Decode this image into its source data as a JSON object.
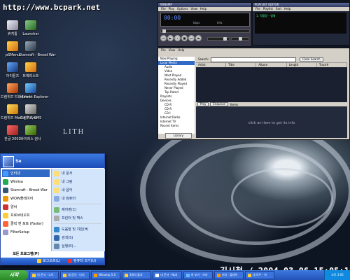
{
  "watermark": "http://www.bcpark.net",
  "brand_text": "LITH",
  "datestamp": "김시철 / 2004-03-06 15:05:18",
  "desktop_icons": [
    {
      "label": "휴지통",
      "icon": "recycle-bin-icon"
    },
    {
      "label": "Launcher",
      "icon": "launcher-icon"
    },
    {
      "label": "pSMenu",
      "icon": "app-icon"
    },
    {
      "label": "Starcraft - Brood War",
      "icon": "game-icon"
    },
    {
      "label": "아이튠즈",
      "icon": "app-icon"
    },
    {
      "label": "트랙리스트",
      "icon": "app-icon"
    },
    {
      "label": "드림위즈 티나(Lite)",
      "icon": "app-icon"
    },
    {
      "label": "Internet Explorer",
      "icon": "ie-icon"
    },
    {
      "label": "드림위즈 Media Player",
      "icon": "media-icon"
    },
    {
      "label": "드림위즈 SMS",
      "icon": "sms-icon"
    },
    {
      "label": "한글 2002",
      "icon": "document-icon"
    },
    {
      "label": "바이러스 검사",
      "icon": "shield-icon"
    }
  ],
  "start_menu": {
    "user_name": "Se",
    "left_items": [
      {
        "label": "인터넷",
        "sub": "Internet Explorer",
        "icon": "ie-icon",
        "selected": true
      },
      {
        "label": "Winlisa",
        "icon": "app-icon"
      },
      {
        "label": "Starcraft - Brood War",
        "icon": "game-icon"
      },
      {
        "label": "WOW플레이어",
        "icon": "media-icon"
      },
      {
        "label": "알씨",
        "icon": "image-icon"
      },
      {
        "label": "프로브네오프",
        "icon": "app-icon"
      },
      {
        "label": "클릭 앤 포토 (Faster)",
        "icon": "photo-icon"
      },
      {
        "label": "FilterSetup",
        "icon": "setup-icon"
      }
    ],
    "all_programs_label": "모든 프로그램(P)",
    "right_items": [
      {
        "label": "내 문서",
        "icon": "folder-icon"
      },
      {
        "label": "내 그림",
        "icon": "folder-icon"
      },
      {
        "label": "내 음악",
        "icon": "folder-icon"
      },
      {
        "label": "내 컴퓨터",
        "icon": "computer-icon"
      },
      {
        "label": "제어판(C)",
        "icon": "control-panel-icon"
      },
      {
        "label": "프린터 및 팩스",
        "icon": "printer-icon"
      },
      {
        "label": "도움말 및 지원(H)",
        "icon": "help-icon"
      },
      {
        "label": "검색(S)",
        "icon": "search-icon"
      },
      {
        "label": "실행(R)...",
        "icon": "run-icon"
      }
    ],
    "logoff_label": "로그오프(L)",
    "shutdown_label": "컴퓨터 끄기(U)"
  },
  "winamp": {
    "title": "WINAMP",
    "menu": [
      "File",
      "Play",
      "Options",
      "View",
      "Help"
    ],
    "time": "00:00",
    "bitrate": "kbps",
    "khz": "kHz"
  },
  "playlist": {
    "title": "PLAYLIST EDITOR",
    "menu": [
      "File",
      "Playlist",
      "Sort",
      "Help"
    ],
    "track": "1. 먹을랑 - 엠체"
  },
  "media_library": {
    "menu": [
      "File",
      "View",
      "Help"
    ],
    "search_label": "Search:",
    "clear_label": "Clear Search",
    "tree": [
      {
        "label": "Now Playing",
        "level": 0
      },
      {
        "label": "Local Media",
        "level": 0,
        "selected": true
      },
      {
        "label": "Audio",
        "level": 1
      },
      {
        "label": "Video",
        "level": 1
      },
      {
        "label": "Most Played",
        "level": 1
      },
      {
        "label": "Recently Added",
        "level": 1
      },
      {
        "label": "Recently Played",
        "level": 1
      },
      {
        "label": "Never Played",
        "level": 1
      },
      {
        "label": "Top Rated",
        "level": 1
      },
      {
        "label": "Playlists",
        "level": 0
      },
      {
        "label": "Devices",
        "level": 0
      },
      {
        "label": "CD-R",
        "level": 1
      },
      {
        "label": "CD-R",
        "level": 1
      },
      {
        "label": "CD-I",
        "level": 1
      },
      {
        "label": "Internet Radio",
        "level": 0
      },
      {
        "label": "Internet TV",
        "level": 0
      },
      {
        "label": "Recent Items",
        "level": 0
      }
    ],
    "columns": [
      "Artist",
      "Title",
      "Album",
      "Length",
      "Track#"
    ],
    "buttons": [
      "Play",
      "Enqueue",
      "Items"
    ],
    "info_text": "click an item to get its info",
    "library_button": "Library"
  },
  "taskbar": {
    "start_label": "시작",
    "buttons": [
      {
        "label": "내 문서 - 노트",
        "icon": "folder-icon"
      },
      {
        "label": "내 음악 - 다리",
        "icon": "folder-icon"
      },
      {
        "label": "Winamp 5.0",
        "icon": "media-icon"
      },
      {
        "label": "3개의 출처",
        "icon": "folder-icon"
      },
      {
        "label": "내 문서 - Noti",
        "icon": "document-icon"
      },
      {
        "label": "바 보기 - 브라",
        "icon": "ie-icon"
      },
      {
        "label": "미리 - 플레이",
        "icon": "media-icon"
      },
      {
        "label": "내 모두 - 아",
        "icon": "folder-icon"
      }
    ],
    "clock": "오후 3:05"
  }
}
